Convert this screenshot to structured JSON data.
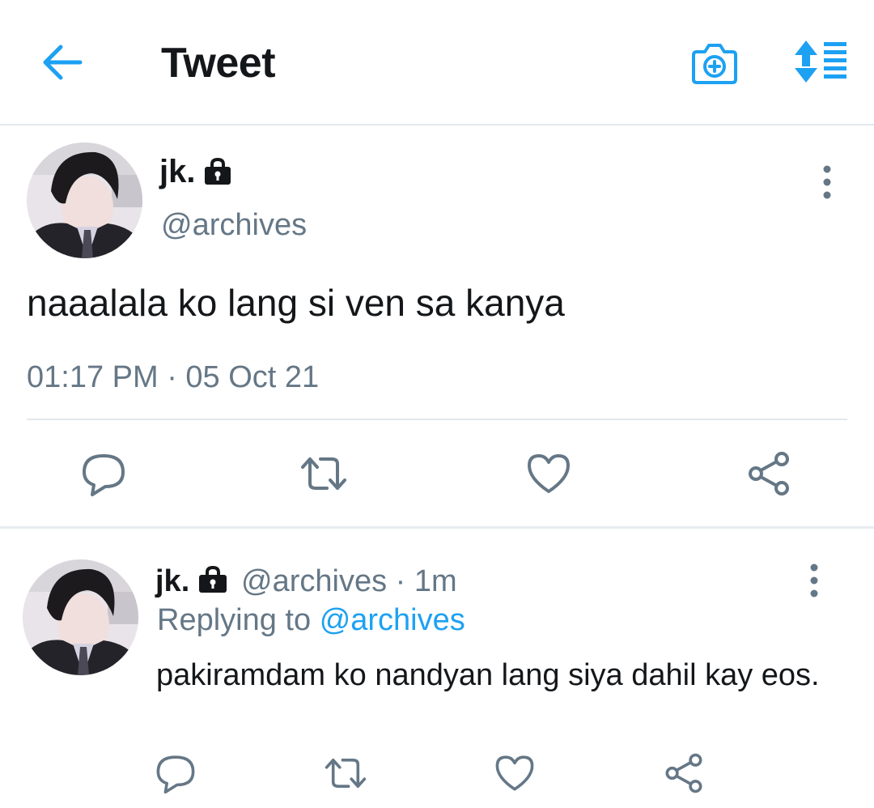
{
  "header": {
    "title": "Tweet",
    "back_icon": "back-arrow-icon",
    "camera_icon": "camera-plus-icon",
    "sort_icon": "sort-list-icon",
    "accent_color": "#1da1f2"
  },
  "main_tweet": {
    "display_name": "jk.",
    "protected_icon": "lock-icon",
    "handle": "@archives",
    "text": "naaalala ko lang si ven sa kanya",
    "timestamp": "01:17 PM · 05 Oct 21",
    "actions": [
      "reply-icon",
      "retweet-icon",
      "like-icon",
      "share-icon"
    ]
  },
  "reply_tweet": {
    "display_name": "jk.",
    "protected_icon": "lock-icon",
    "handle_time": "@archives · 1m",
    "replying_prefix": "Replying to",
    "replying_to": "@archives",
    "text": "pakiramdam ko nandyan lang siya dahil kay eos.",
    "actions": [
      "reply-icon",
      "retweet-icon",
      "like-icon",
      "share-icon"
    ]
  },
  "colors": {
    "text_primary": "#14171a",
    "text_secondary": "#657786",
    "divider": "#e1e8ed",
    "icon": "#657786"
  }
}
